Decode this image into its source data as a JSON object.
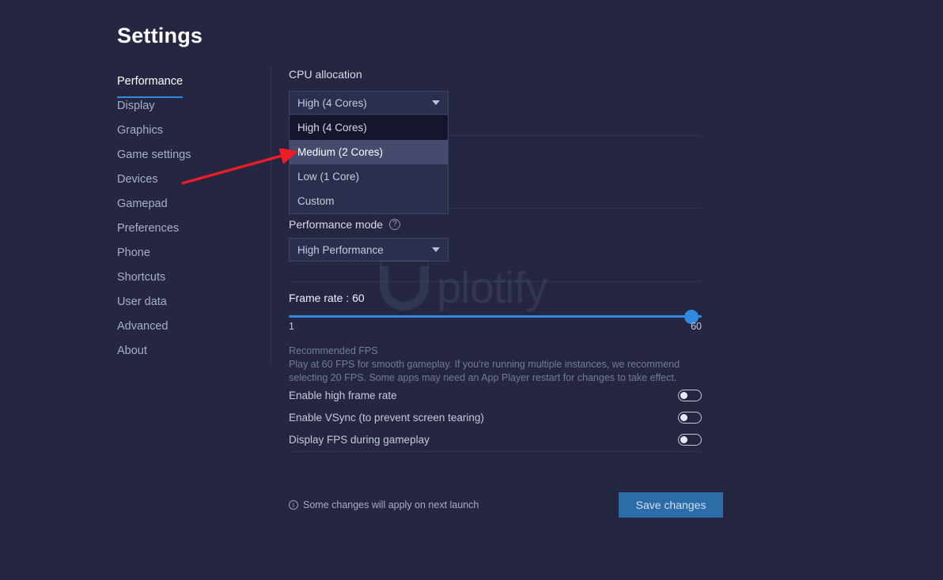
{
  "page": {
    "title": "Settings",
    "background_color": "#242642",
    "accent_color": "#2f8ae0"
  },
  "watermark": {
    "text": "plotify",
    "logo": "u-logo-icon"
  },
  "sidebar": {
    "items": [
      {
        "label": "Performance",
        "active": true
      },
      {
        "label": "Display",
        "active": false
      },
      {
        "label": "Graphics",
        "active": false
      },
      {
        "label": "Game settings",
        "active": false
      },
      {
        "label": "Devices",
        "active": false
      },
      {
        "label": "Gamepad",
        "active": false
      },
      {
        "label": "Preferences",
        "active": false
      },
      {
        "label": "Phone",
        "active": false
      },
      {
        "label": "Shortcuts",
        "active": false
      },
      {
        "label": "User data",
        "active": false
      },
      {
        "label": "Advanced",
        "active": false
      },
      {
        "label": "About",
        "active": false
      }
    ]
  },
  "cpu_allocation": {
    "label": "CPU allocation",
    "selected": "High (4 Cores)",
    "expanded": true,
    "options": [
      {
        "label": "High (4 Cores)",
        "state": "selected"
      },
      {
        "label": "Medium (2 Cores)",
        "state": "hovered"
      },
      {
        "label": "Low (1 Core)",
        "state": "normal"
      },
      {
        "label": "Custom",
        "state": "normal"
      }
    ]
  },
  "performance_mode": {
    "label": "Performance mode",
    "help_icon": "question-mark-icon",
    "selected": "High Performance"
  },
  "frame_rate": {
    "label": "Frame rate : 60",
    "value": 60,
    "min_label": "1",
    "max_label": "60",
    "min": 1,
    "max": 60,
    "recommended_title": "Recommended FPS",
    "recommended_body": "Play at 60 FPS for smooth gameplay. If you're running multiple instances, we recommend selecting 20 FPS. Some apps may need an App Player restart for changes to take effect."
  },
  "toggles": [
    {
      "label": "Enable high frame rate",
      "on": false
    },
    {
      "label": "Enable VSync (to prevent screen tearing)",
      "on": false
    },
    {
      "label": "Display FPS during gameplay",
      "on": false
    }
  ],
  "footer": {
    "note": "Some changes will apply on next launch",
    "note_icon": "info-icon",
    "save_label": "Save changes"
  },
  "annotation": {
    "arrow": "red-arrow-pointing-to-medium-option",
    "color": "#ee1c25"
  }
}
